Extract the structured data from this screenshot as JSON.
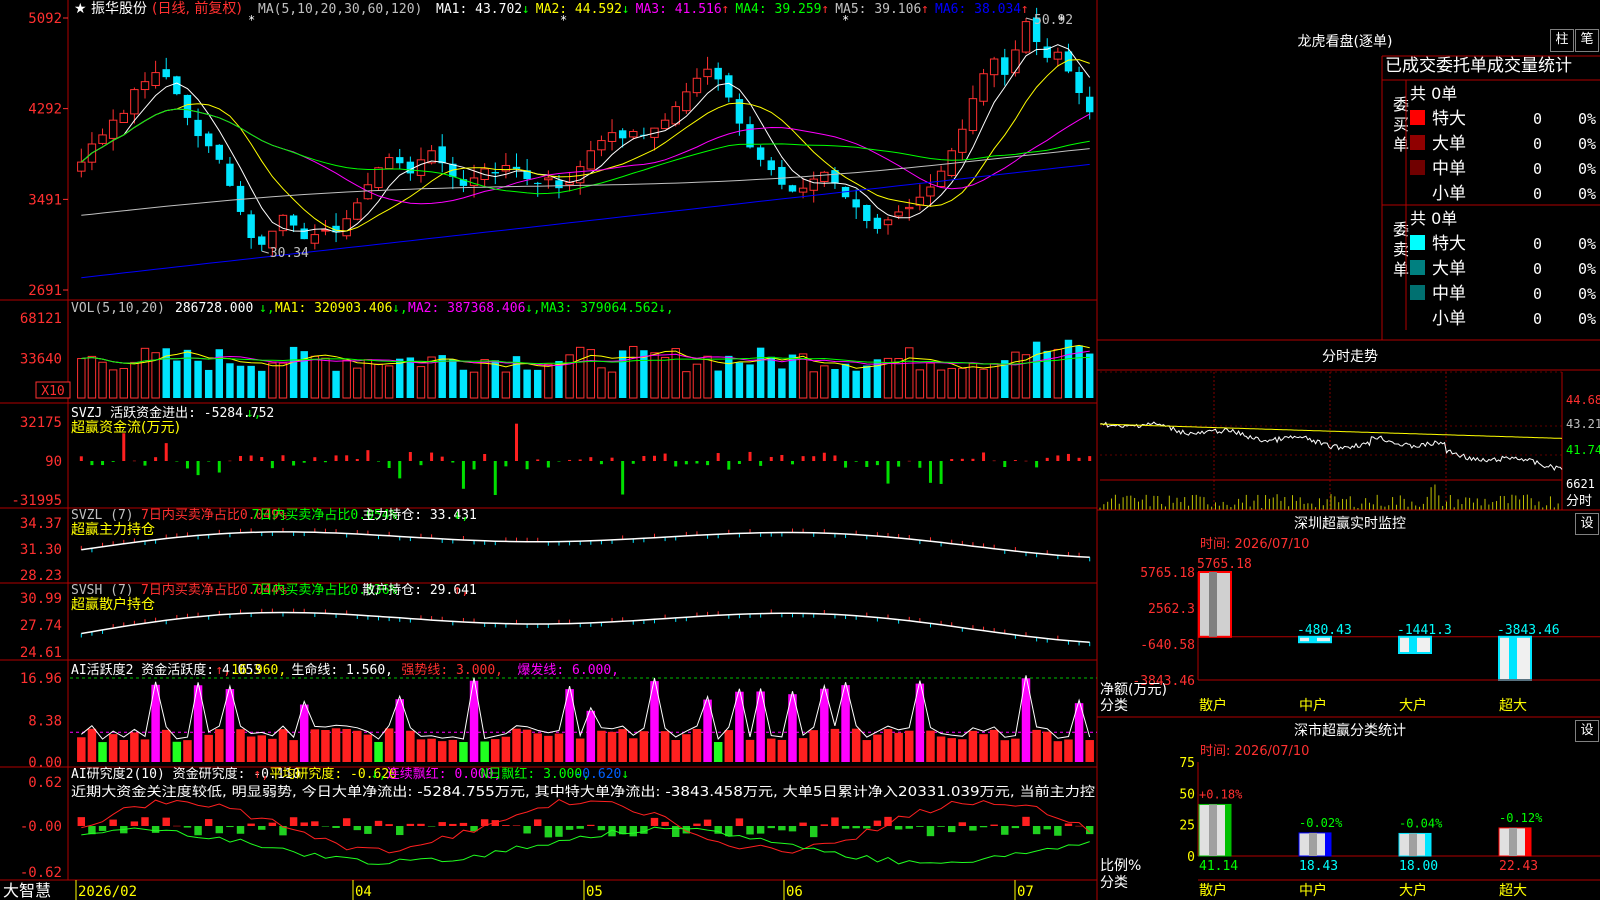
{
  "app": {
    "brand": "大智慧"
  },
  "main": {
    "stock": "振华股份",
    "mode": "(日线, 前复权)",
    "ma_label": "MA(5,10,20,30,60,120)",
    "ma": [
      {
        "label": "MA1: 43.702",
        "color": "#ffffff"
      },
      {
        "label": "MA2: 44.592",
        "color": "#ffff00"
      },
      {
        "label": "MA3: 41.516",
        "color": "#ff00ff"
      },
      {
        "label": "MA4: 39.259",
        "color": "#00ff00"
      },
      {
        "label": "MA5: 39.106",
        "color": "#c0c0c0"
      },
      {
        "label": "MA6: 38.034",
        "color": "#0000ff"
      }
    ],
    "ma_arrows": [
      "↓",
      "↓",
      "↑",
      "↑",
      "↑",
      "↑"
    ],
    "y_ticks": [
      "5092",
      "4292",
      "3491",
      "2691"
    ],
    "high_label": "50.92",
    "low_label": "30.34"
  },
  "vol": {
    "label": "VOL(5,10,20)",
    "value": "286728.000",
    "ma": [
      {
        "label": "MA1: 320903.406",
        "color": "#ffff00"
      },
      {
        "label": "MA2: 387368.406",
        "color": "#ff00ff"
      },
      {
        "label": "MA3: 379064.562",
        "color": "#00ff00"
      }
    ],
    "y_ticks": [
      "68121",
      "33640"
    ],
    "unit": "X10"
  },
  "svzj": {
    "label": "SVZJ  活跃资金进出: -5284.752",
    "sub": "超赢资金流(万元)",
    "y_ticks": [
      "32175",
      "90",
      "-31995"
    ]
  },
  "svzl": {
    "label": "SVZL (7)",
    "a": "7日内买卖净占比0.049%",
    "b": "7日内买卖净占比0.054%",
    "c": "主力持仓: 33.431",
    "sub": "超赢主力持仓",
    "y_ticks": [
      "34.37",
      "31.30",
      "28.23"
    ]
  },
  "svsh": {
    "label": "SVSH (7)",
    "a": "7日内买卖净占比0.044%",
    "b": "7日内买卖净占比0.036%",
    "c": "散户持仓: 29.641",
    "sub": "超赢散户持仓",
    "y_ticks": [
      "30.99",
      "27.74",
      "24.61"
    ]
  },
  "ai1": {
    "label": "AI活跃度2 资金活跃度: 4.053",
    "b": "16.960",
    "c": "生命线: 1.560",
    "d": "强势线: 3.000",
    "e": "爆发线: 6.000",
    "y_ticks": [
      "16.96",
      "8.38",
      "0.00"
    ]
  },
  "ai2": {
    "label": "AI研究度2(10) 资金研究度: -0.110",
    "b": "平均研究度: -0.620",
    "c": "连续飘红: 0.000",
    "d": "N日飘红: 3.000",
    "e": "-0.620",
    "comment": "近期大资金关注度较低, 明显弱势, 今日大单净流出: -5284.755万元, 其中特大单净流出: -3843.458万元, 大单5日累计净入20331.039万元, 当前主力控",
    "y_ticks": [
      "0.62",
      "-0.00",
      "-0.62"
    ]
  },
  "xaxis": {
    "labels": [
      "2026/02",
      "04",
      "05",
      "06",
      "07"
    ]
  },
  "side": {
    "title": "龙虎看盘(逐单)",
    "btn_zhu": "柱",
    "btn_bi": "笔",
    "tabs": "已成交委托单成交量统计",
    "buy_group": "委买单",
    "sell_group": "委卖单",
    "buy_total": "共 0单",
    "sell_total": "共 0单",
    "rows": [
      "特大",
      "大单",
      "中单",
      "小单"
    ],
    "count": "0",
    "pct": "0%",
    "fenshi_title": "分时走势",
    "fenshi_prices": [
      "44.68",
      "43.21",
      "41.74"
    ],
    "fenshi_vol": "6621",
    "fenshi_unit": "分时",
    "sz_title": "深圳超赢实时监控",
    "sz_time": "时间: 2026/07/10",
    "sz_ticks": [
      "5765.18",
      "2562.3",
      "-640.58",
      "-3843.46"
    ],
    "sz_unit": "净额(万元)",
    "sz_cat": "分类",
    "sz_vals": [
      "5765.18",
      "-480.43",
      "-1441.3",
      "-3843.46"
    ],
    "set": "设",
    "cls_title": "深市超赢分类统计",
    "cls_time": "时间: 2026/07/10",
    "cls_ticks": [
      "75",
      "50",
      "25",
      "0"
    ],
    "cls_unit": "比例%",
    "cls_cat": "分类",
    "cls_vals": [
      "41.14",
      "18.43",
      "18.00",
      "22.43"
    ],
    "cls_chg": [
      "+0.18%",
      "-0.02%",
      "-0.04%",
      "-0.12%"
    ],
    "cats": [
      "散户",
      "中户",
      "大户",
      "超大"
    ]
  },
  "chart_data": [
    {
      "type": "candlestick",
      "title": "振华股份 (日线, 前复权)",
      "x": [
        "2026/02",
        "04",
        "05",
        "06",
        "07"
      ],
      "ylim": [
        26.91,
        50.92
      ],
      "high": 50.92,
      "low": 30.34,
      "ma": {
        "MA1": 43.702,
        "MA2": 44.592,
        "MA3": 41.516,
        "MA4": 39.259,
        "MA5": 39.106,
        "MA6": 38.034
      },
      "close_path": [
        38.2,
        39.8,
        40.6,
        41.9,
        42.5,
        44.6,
        45.3,
        46.1,
        45.7,
        44.2,
        42.1,
        40.5,
        39.6,
        38.4,
        36.1,
        33.8,
        31.5,
        30.9,
        32.1,
        33.5,
        32.6,
        31.4,
        31.8,
        32.2,
        32.0,
        33.2,
        34.6,
        36.2,
        37.7,
        38.6,
        38.1,
        37.2,
        38.4,
        39.2,
        38.1,
        36.9,
        36.1,
        36.8,
        37.6,
        37.2,
        37.9,
        37.6,
        36.7,
        36.3,
        36.8,
        35.9,
        36.4,
        37.8,
        39.2,
        40.1,
        40.8,
        40.3,
        40.9,
        40.6,
        41.2,
        41.9,
        43.1,
        44.4,
        45.6,
        46.4,
        45.5,
        43.9,
        41.6,
        39.5,
        38.4,
        37.5,
        36.2,
        35.6,
        35.9,
        36.7,
        37.3,
        36.3,
        35.1,
        34.2,
        33.0,
        32.3,
        33.1,
        33.8,
        34.2,
        35.1,
        36.0,
        37.4,
        39.2,
        41.1,
        43.8,
        46.0,
        47.3,
        45.9,
        48.1,
        50.6,
        48.8,
        47.4,
        47.9,
        46.2,
        44.3,
        42.6
      ]
    },
    {
      "type": "bar",
      "title": "VOL(5,10,20)",
      "ylim": [
        0,
        68121
      ],
      "ticks": [
        68121,
        33640
      ],
      "unit": "X10",
      "last": 286728.0,
      "ma": {
        "MA1": 320903.406,
        "MA2": 387368.406,
        "MA3": 379064.562
      }
    },
    {
      "type": "bar",
      "title": "SVZJ 活跃资金进出",
      "ylim": [
        -31995,
        32175
      ],
      "last": -5284.752
    },
    {
      "type": "line",
      "title": "SVZL 主力持仓",
      "ylim": [
        28.23,
        34.37
      ],
      "last": 33.431
    },
    {
      "type": "line",
      "title": "SVSH 散户持仓",
      "ylim": [
        24.61,
        30.99
      ],
      "last": 29.641
    },
    {
      "type": "bar",
      "title": "AI活跃度2",
      "ylim": [
        0,
        16.96
      ],
      "last": 4.053,
      "lines": {
        "强势线": 3.0,
        "爆发线": 6.0,
        "生命线": 1.56
      }
    },
    {
      "type": "bar",
      "title": "AI研究度2(10)",
      "ylim": [
        -0.62,
        0.62
      ],
      "last": -0.11,
      "avg": -0.62
    },
    {
      "type": "bar",
      "title": "深圳超赢实时监控",
      "categories": [
        "散户",
        "中户",
        "大户",
        "超大"
      ],
      "values": [
        5765.18,
        -480.43,
        -1441.3,
        -3843.46
      ],
      "ylim": [
        -3843.46,
        5765.18
      ],
      "ylabel": "净额(万元)"
    },
    {
      "type": "bar",
      "title": "深市超赢分类统计",
      "categories": [
        "散户",
        "中户",
        "大户",
        "超大"
      ],
      "values": [
        41.14,
        18.43,
        18.0,
        22.43
      ],
      "changes": [
        "+0.18%",
        "-0.02%",
        "-0.04%",
        "-0.12%"
      ],
      "ylim": [
        0,
        75
      ],
      "ylabel": "比例%"
    }
  ]
}
